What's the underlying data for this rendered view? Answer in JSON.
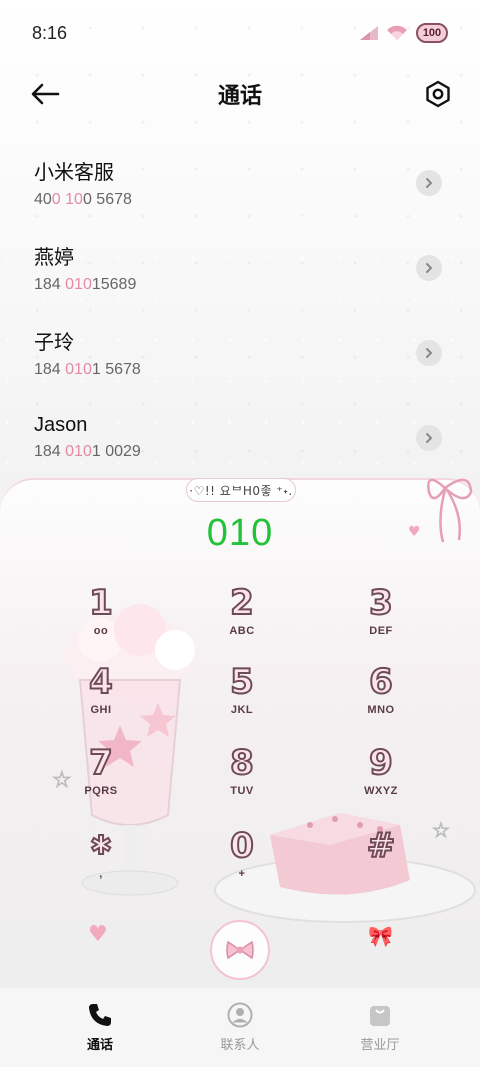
{
  "status_bar": {
    "time": "8:16",
    "battery": "100"
  },
  "header": {
    "title": "通话",
    "back_icon": "arrow-left-icon",
    "settings_icon": "gear-hexagon-icon"
  },
  "contacts": [
    {
      "name": "小米客服",
      "number_parts": [
        "400",
        " ",
        "10",
        "0 5678"
      ],
      "number_pre": "40",
      "number_hl1": "0",
      "number_mid": " ",
      "number_hl2": "10",
      "number_post": "0 5678"
    },
    {
      "name": "燕婷",
      "number_pre": "184 ",
      "number_hl1": "010",
      "number_mid": "",
      "number_hl2": "",
      "number_post": "15689"
    },
    {
      "name": "子玲",
      "number_pre": "184 ",
      "number_hl1": "010",
      "number_mid": "",
      "number_hl2": "",
      "number_post": "1 5678"
    },
    {
      "name": "Jason",
      "number_pre": "184 ",
      "number_hl1": "010",
      "number_mid": "",
      "number_hl2": "",
      "number_post": "1 0029"
    }
  ],
  "dialpad": {
    "tag_text": "·♡!! 요ᄇ᠌H0좋 ⁺˖.",
    "dialed_number": "010",
    "keys": [
      {
        "digit": "1",
        "letters": "ᴏᴏ"
      },
      {
        "digit": "2",
        "letters": "ABC"
      },
      {
        "digit": "3",
        "letters": "DEF"
      },
      {
        "digit": "4",
        "letters": "GHI"
      },
      {
        "digit": "5",
        "letters": "JKL"
      },
      {
        "digit": "6",
        "letters": "MNO"
      },
      {
        "digit": "7",
        "letters": "PQRS"
      },
      {
        "digit": "8",
        "letters": "TUV"
      },
      {
        "digit": "9",
        "letters": "WXYZ"
      },
      {
        "digit": "✱",
        "letters": ","
      },
      {
        "digit": "0",
        "letters": "+"
      },
      {
        "digit": "#",
        "letters": ""
      }
    ]
  },
  "bottom_nav": {
    "items": [
      {
        "label": "通话",
        "icon": "phone-icon",
        "active": true
      },
      {
        "label": "联系人",
        "icon": "person-icon",
        "active": false
      },
      {
        "label": "营业厅",
        "icon": "shopping-bag-icon",
        "active": false
      }
    ]
  },
  "colors": {
    "accent_pink": "#e58aa3",
    "dialed_green": "#22c23a",
    "key_outline": "#6e4a56"
  }
}
